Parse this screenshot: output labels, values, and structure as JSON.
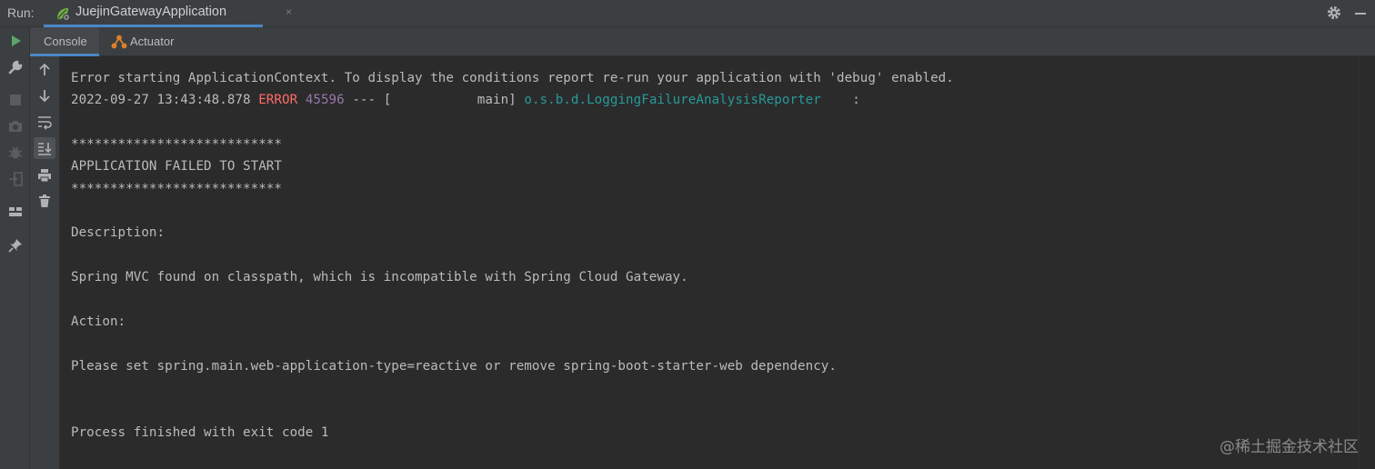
{
  "header": {
    "run_label": "Run:",
    "tab_title": "JuejinGatewayApplication",
    "tab_close": "×"
  },
  "subtabs": {
    "console": "Console",
    "actuator": "Actuator"
  },
  "console": {
    "lines": [
      "Error starting ApplicationContext. To display the conditions report re-run your application with 'debug' enabled.",
      "",
      "***************************",
      "APPLICATION FAILED TO START",
      "***************************",
      "Description:",
      "Spring MVC found on classpath, which is incompatible with Spring Cloud Gateway.",
      "Action:",
      "Please set spring.main.web-application-type=reactive or remove spring-boot-starter-web dependency.",
      "Process finished with exit code 1"
    ],
    "log_line": {
      "timestamp": "2022-09-27 13:43:48.878",
      "level": "ERROR",
      "pid": "45596",
      "separator": "--- [",
      "thread": "           main]",
      "logger": "o.s.b.d.LoggingFailureAnalysisReporter",
      "colon": ":"
    }
  },
  "watermark": "@稀土掘金技术社区",
  "colors": {
    "background": "#2b2b2b",
    "panel": "#3c3f41",
    "accent": "#4a88c7",
    "error": "#ff6b68",
    "pid": "#9876aa",
    "logger": "#299999",
    "run_green": "#59a869"
  },
  "icons": {
    "run": "play-icon",
    "wrench": "wrench-icon",
    "stop": "stop-icon",
    "camera": "camera-icon",
    "debug": "bug-icon",
    "exit": "exit-icon",
    "layout": "layout-icon",
    "pin": "pin-icon",
    "up": "arrow-up-icon",
    "down": "arrow-down-icon",
    "wrap": "soft-wrap-icon",
    "scroll": "scroll-to-end-icon",
    "print": "print-icon",
    "trash": "trash-icon",
    "settings": "gear-icon"
  }
}
